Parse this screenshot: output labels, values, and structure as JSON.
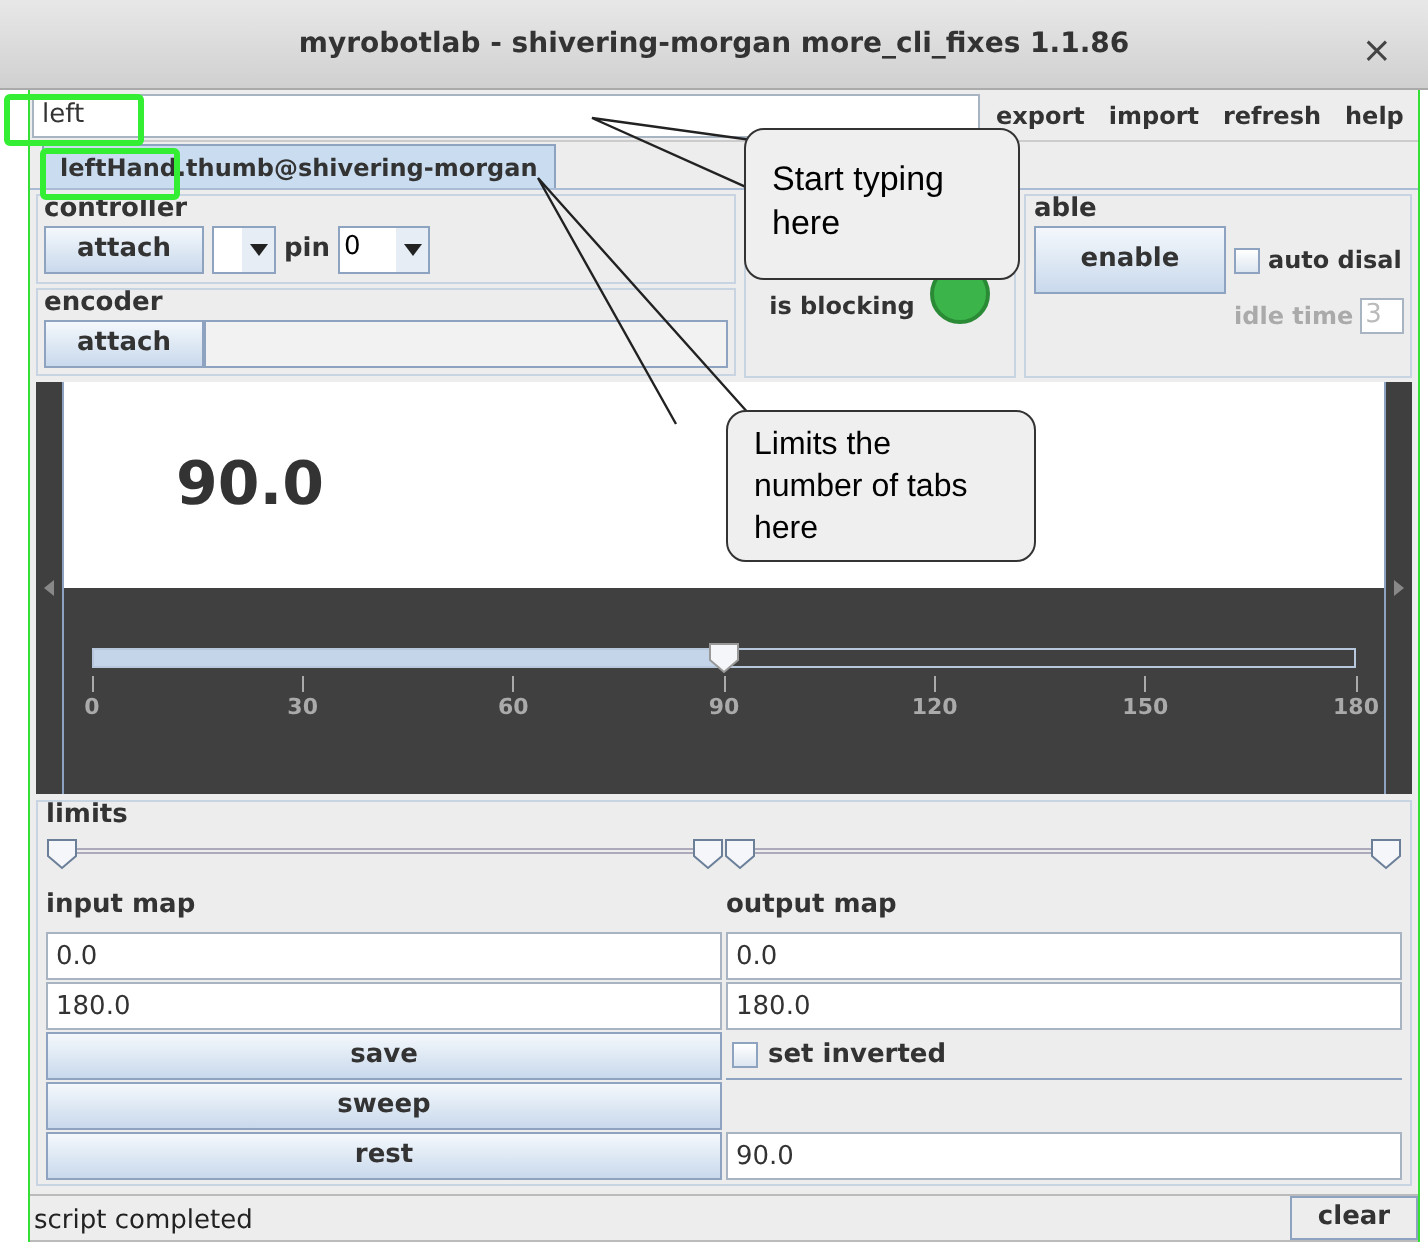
{
  "window": {
    "title": "myrobotlab - shivering-morgan more_cli_fixes 1.1.86",
    "close": "×"
  },
  "search": {
    "value": "left"
  },
  "menu": [
    "export",
    "import",
    "refresh",
    "help"
  ],
  "tabs": [
    {
      "label": "leftHand.thumb@shivering-morgan",
      "selected": true
    }
  ],
  "controller": {
    "title": "controller",
    "attach": "attach",
    "pin_label": "pin",
    "pin": "0"
  },
  "encoder": {
    "title": "encoder",
    "attach": "attach"
  },
  "blocking": {
    "label": "is blocking",
    "on": true
  },
  "enable": {
    "title": "able",
    "button": "enable",
    "auto_disable": {
      "label": "auto disal",
      "checked": false
    },
    "idle_label": "idle time",
    "idle_value": "3"
  },
  "position": {
    "reading": "90.0",
    "level": 0.5,
    "ticks": [
      "0",
      "30",
      "60",
      "90",
      "120",
      "150",
      "180"
    ]
  },
  "limits": {
    "title": "limits",
    "sliders": [
      {
        "low": {
          "level": 0
        },
        "high": {
          "level": 1
        }
      },
      {
        "low": {
          "level": 0
        },
        "high": {
          "level": 1
        }
      }
    ]
  },
  "input_map": {
    "label": "input map",
    "min": "0.0",
    "max": "180.0"
  },
  "output_map": {
    "label": "output map",
    "min": "0.0",
    "max": "180.0"
  },
  "buttons": {
    "save": "save",
    "sweep": "sweep",
    "rest": "rest"
  },
  "set_inverted": {
    "label": "set inverted",
    "checked": false
  },
  "rest_value": "90.0",
  "status": {
    "text": "script completed",
    "clear": "clear"
  },
  "callouts": [
    {
      "text": "Start typing here"
    },
    {
      "text": "Limits the number of tabs here"
    }
  ]
}
